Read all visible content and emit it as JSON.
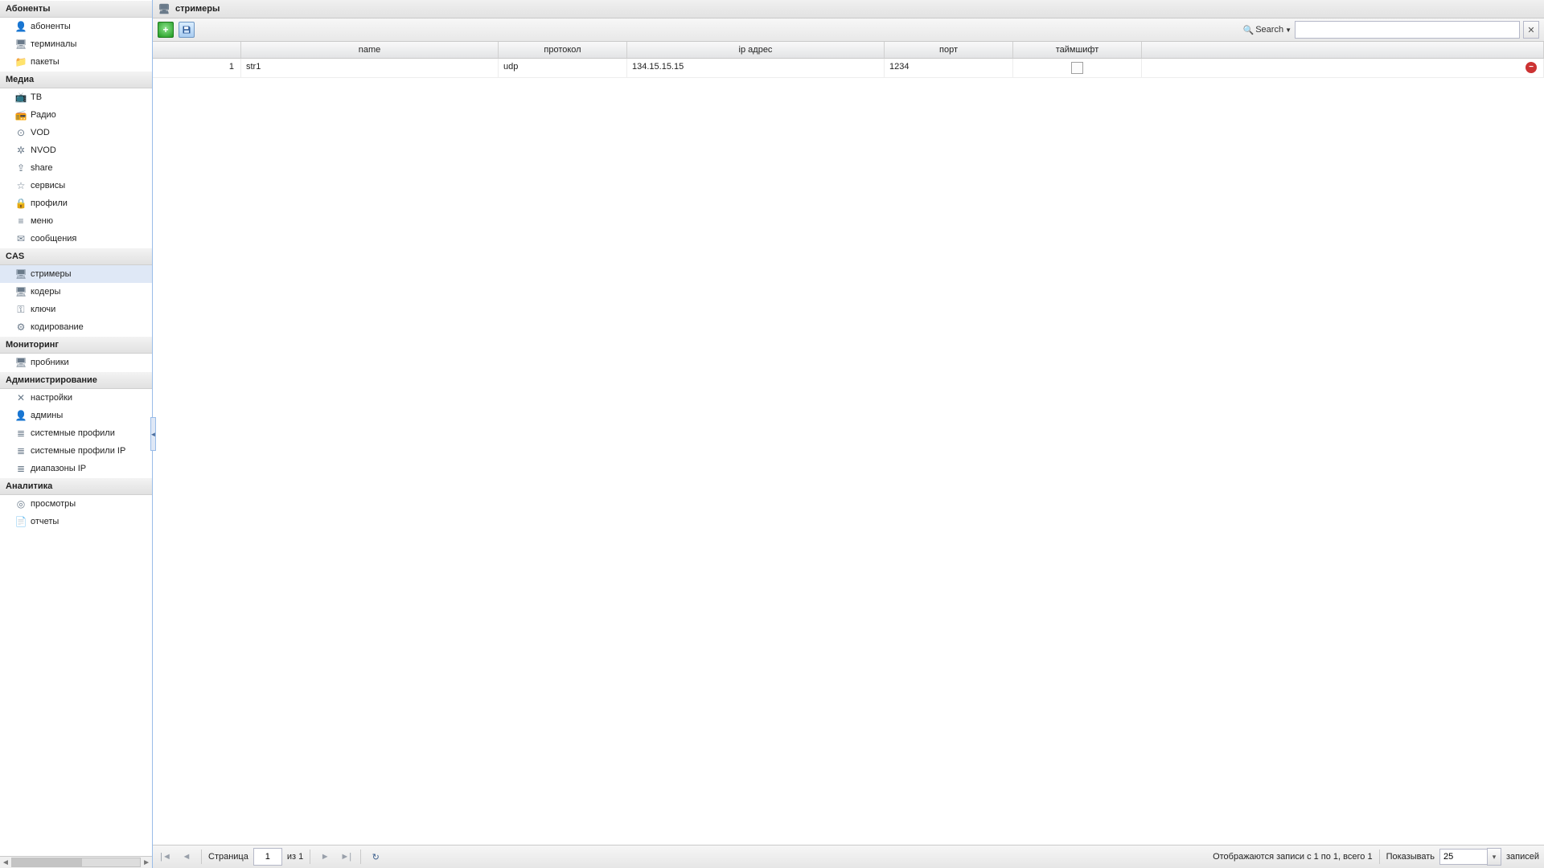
{
  "sidebar": {
    "groups": [
      {
        "title": "Абоненты",
        "items": [
          {
            "label": "абоненты",
            "icon": "user-icon"
          },
          {
            "label": "терминалы",
            "icon": "terminal-icon"
          },
          {
            "label": "пакеты",
            "icon": "folder-icon"
          }
        ]
      },
      {
        "title": "Медиа",
        "items": [
          {
            "label": "ТВ",
            "icon": "tv-icon"
          },
          {
            "label": "Радио",
            "icon": "radio-icon"
          },
          {
            "label": "VOD",
            "icon": "vod-icon"
          },
          {
            "label": "NVOD",
            "icon": "nvod-icon"
          },
          {
            "label": "share",
            "icon": "share-icon"
          },
          {
            "label": "сервисы",
            "icon": "star-icon"
          },
          {
            "label": "профили",
            "icon": "lock-icon"
          },
          {
            "label": "меню",
            "icon": "menu-icon"
          },
          {
            "label": "сообщения",
            "icon": "message-icon"
          }
        ]
      },
      {
        "title": "CAS",
        "items": [
          {
            "label": "стримеры",
            "icon": "server-icon",
            "active": true
          },
          {
            "label": "кодеры",
            "icon": "encoder-icon"
          },
          {
            "label": "ключи",
            "icon": "key-icon"
          },
          {
            "label": "кодирование",
            "icon": "encoding-icon"
          }
        ]
      },
      {
        "title": "Мониторинг",
        "items": [
          {
            "label": "пробники",
            "icon": "probe-icon"
          }
        ]
      },
      {
        "title": "Администрирование",
        "items": [
          {
            "label": "настройки",
            "icon": "settings-icon"
          },
          {
            "label": "админы",
            "icon": "admin-icon"
          },
          {
            "label": "системные профили",
            "icon": "sysprofile-icon"
          },
          {
            "label": "системные профили IP",
            "icon": "sysprofile-ip-icon"
          },
          {
            "label": "диапазоны IP",
            "icon": "iprange-icon"
          }
        ]
      },
      {
        "title": "Аналитика",
        "items": [
          {
            "label": "просмотры",
            "icon": "views-icon"
          },
          {
            "label": "отчеты",
            "icon": "reports-icon"
          }
        ]
      }
    ]
  },
  "panel": {
    "title": "стримеры"
  },
  "toolbar": {
    "search_label": "Search"
  },
  "grid": {
    "columns": {
      "num": "",
      "name": "name",
      "protocol": "протокол",
      "ip": "ip адрес",
      "port": "порт",
      "timeshift": "таймшифт"
    },
    "rows": [
      {
        "num": "1",
        "name": "str1",
        "protocol": "udp",
        "ip": "134.15.15.15",
        "port": "1234",
        "timeshift": false
      }
    ]
  },
  "paging": {
    "page_label": "Страница",
    "page_value": "1",
    "of_label": "из 1",
    "display_info": "Отображаются записи с 1 по 1, всего 1",
    "pagesize_label": "Показывать",
    "pagesize_value": "25",
    "records_label": "записей"
  },
  "icon_glyphs": {
    "user-icon": "👤",
    "terminal-icon": "🖥",
    "folder-icon": "📁",
    "tv-icon": "📺",
    "radio-icon": "📻",
    "vod-icon": "⊙",
    "nvod-icon": "✲",
    "share-icon": "⇪",
    "star-icon": "☆",
    "lock-icon": "🔒",
    "menu-icon": "≡",
    "message-icon": "✉",
    "server-icon": "🖥",
    "encoder-icon": "🖥",
    "key-icon": "⚿",
    "encoding-icon": "⚙",
    "probe-icon": "🖥",
    "settings-icon": "✕",
    "admin-icon": "👤",
    "sysprofile-icon": "≣",
    "sysprofile-ip-icon": "≣",
    "iprange-icon": "≣",
    "views-icon": "◎",
    "reports-icon": "📄"
  }
}
